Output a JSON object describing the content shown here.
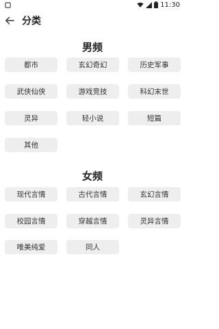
{
  "status_bar": {
    "time": "11:30"
  },
  "header": {
    "title": "分类"
  },
  "male": {
    "title": "男频",
    "items": [
      "都市",
      "玄幻奇幻",
      "历史军事",
      "武侠仙侠",
      "游戏竞技",
      "科幻末世",
      "灵异",
      "轻小说",
      "短篇",
      "其他"
    ]
  },
  "female": {
    "title": "女频",
    "items": [
      "现代言情",
      "古代言情",
      "玄幻言情",
      "校园言情",
      "穿越言情",
      "灵异言情",
      "唯美纯爱",
      "同人"
    ]
  },
  "colors": {
    "chip_bg": "#eeeeee",
    "text": "#222222"
  },
  "icons": [
    "wifi-icon",
    "signal-icon",
    "battery-icon",
    "back-arrow-icon"
  ]
}
